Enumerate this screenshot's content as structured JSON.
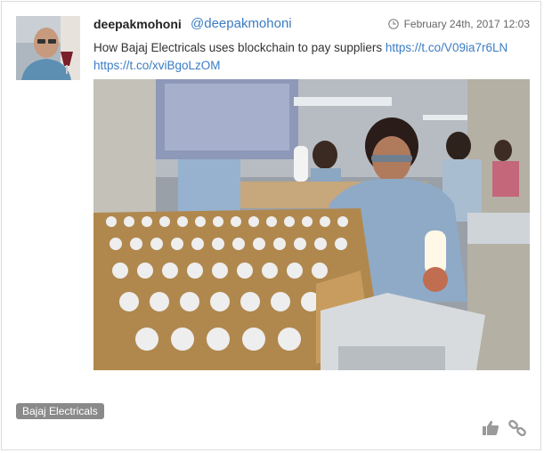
{
  "post": {
    "username": "deepakmohoni",
    "handle": "@deepakmohoni",
    "date": "February 24th, 2017 12:03",
    "text": "How Bajaj Electricals uses blockchain to pay suppliers ",
    "link1": "https://t.co/V09ia7r6LN",
    "link2": "https://t.co/xviBgoLzOM"
  },
  "tags": [
    "Bajaj Electricals"
  ],
  "icons": {
    "clock": "clock-icon",
    "like": "thumbs-up-icon",
    "link": "link-icon"
  },
  "colors": {
    "link": "#3b7cc4",
    "tag_bg": "#8a8a8a",
    "icon": "#9a9a9a"
  }
}
